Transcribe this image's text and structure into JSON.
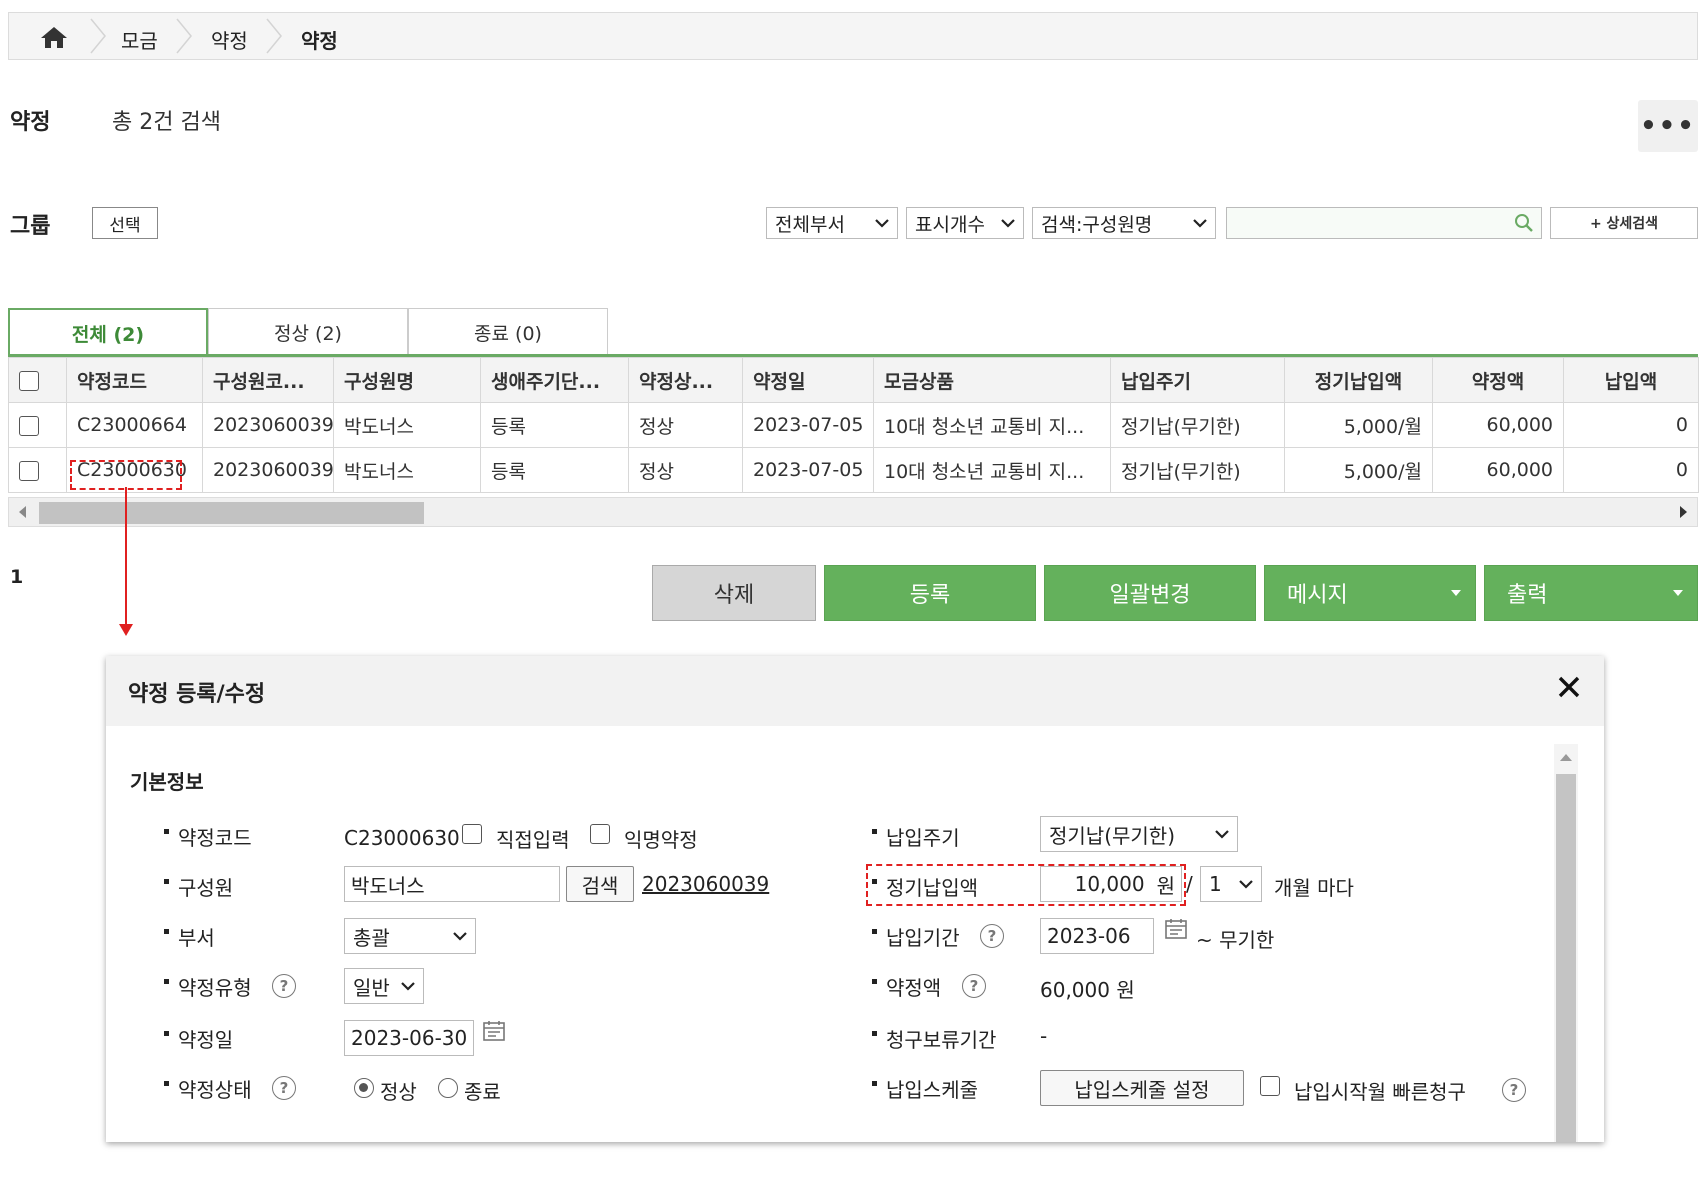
{
  "breadcrumb": {
    "items": [
      "모금",
      "약정",
      "약정"
    ]
  },
  "page": {
    "title": "약정",
    "count_text": "총 2건 검색",
    "more": "•••"
  },
  "filters": {
    "group_label": "그룹",
    "group_button": "선택",
    "department": "전체부서",
    "display_count": "표시개수",
    "search_by": "검색:구성원명",
    "search_value": "",
    "advanced": "+ 상세검색"
  },
  "tabs": [
    {
      "label": "전체 (2)",
      "active": true
    },
    {
      "label": "정상 (2)",
      "active": false
    },
    {
      "label": "종료 (0)",
      "active": false
    }
  ],
  "table": {
    "headers": [
      "약정코드",
      "구성원코...",
      "구성원명",
      "생애주기단...",
      "약정상...",
      "약정일",
      "모금상품",
      "납입주기",
      "정기납입액",
      "약정액",
      "납입액"
    ],
    "rows": [
      [
        "C23000664",
        "2023060039",
        "박도너스",
        "등록",
        "정상",
        "2023-07-05",
        "10대 청소년 교통비 지...",
        "정기납(무기한)",
        "5,000/월",
        "60,000",
        "0"
      ],
      [
        "C23000630",
        "2023060039",
        "박도너스",
        "등록",
        "정상",
        "2023-07-05",
        "10대 청소년 교통비 지...",
        "정기납(무기한)",
        "5,000/월",
        "60,000",
        "0"
      ]
    ]
  },
  "pager": {
    "page": "1"
  },
  "actions": {
    "delete": "삭제",
    "register": "등록",
    "bulk_change": "일괄변경",
    "message": "메시지",
    "print": "출력"
  },
  "modal": {
    "title": "약정 등록/수정",
    "section": "기본정보",
    "left": {
      "code_label": "약정코드",
      "code_value": "C23000630",
      "direct_input": "직접입력",
      "anonymous": "익명약정",
      "member_label": "구성원",
      "member_value": "박도너스",
      "search_btn": "검색",
      "member_code": "2023060039",
      "dept_label": "부서",
      "dept_value": "총괄",
      "type_label": "약정유형",
      "type_value": "일반",
      "date_label": "약정일",
      "date_value": "2023-06-30",
      "status_label": "약정상태",
      "status_normal": "정상",
      "status_end": "종료"
    },
    "right": {
      "cycle_label": "납입주기",
      "cycle_value": "정기납(무기한)",
      "amount_label": "정기납입액",
      "amount_value": "10,000",
      "amount_unit": "원",
      "slash": "/",
      "months_value": "1",
      "months_text": "개월 마다",
      "period_label": "납입기간",
      "period_start": "2023-06",
      "period_end": "~ 무기한",
      "pledge_label": "약정액",
      "pledge_value": "60,000 원",
      "hold_label": "청구보류기간",
      "hold_value": "-",
      "schedule_label": "납입스케줄",
      "schedule_btn": "납입스케줄 설정",
      "fast_claim": "납입시작월 빠른청구"
    },
    "help": "?"
  }
}
